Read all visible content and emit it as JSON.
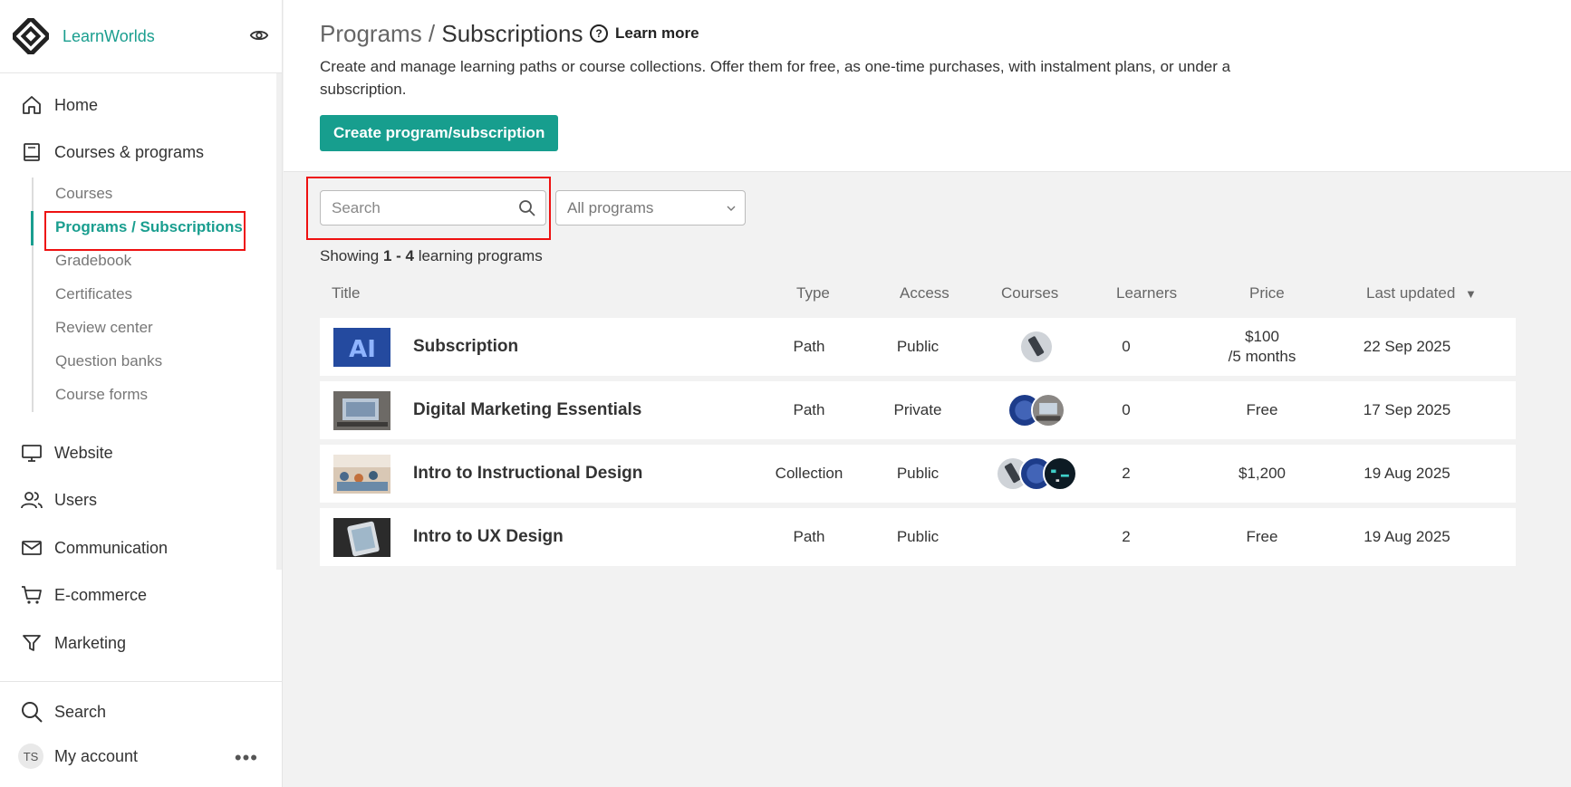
{
  "brand": {
    "name": "LearnWorlds"
  },
  "sidebar": {
    "items": [
      {
        "label": "Home",
        "icon": "home-icon"
      },
      {
        "label": "Courses & programs",
        "icon": "book-icon"
      },
      {
        "label": "Website",
        "icon": "monitor-icon"
      },
      {
        "label": "Users",
        "icon": "users-icon"
      },
      {
        "label": "Communication",
        "icon": "mail-icon"
      },
      {
        "label": "E-commerce",
        "icon": "cart-icon"
      },
      {
        "label": "Marketing",
        "icon": "funnel-icon"
      }
    ],
    "subitems": [
      {
        "label": "Courses"
      },
      {
        "label": "Programs / Subscriptions",
        "active": true
      },
      {
        "label": "Gradebook"
      },
      {
        "label": "Certificates"
      },
      {
        "label": "Review center"
      },
      {
        "label": "Question banks"
      },
      {
        "label": "Course forms"
      }
    ],
    "bottom": {
      "search_label": "Search",
      "account_label": "My account",
      "avatar_initials": "TS"
    }
  },
  "header": {
    "crumb": "Programs / ",
    "title": "Subscriptions",
    "learn_more": "Learn more",
    "description": "Create and manage learning paths or course collections. Offer them for free, as one-time purchases, with instalment plans, or under a subscription.",
    "create_button": "Create program/subscription"
  },
  "filters": {
    "search_placeholder": "Search",
    "program_filter": "All programs"
  },
  "showing": {
    "prefix": "Showing ",
    "range": "1 - 4",
    "suffix": " learning programs"
  },
  "table": {
    "columns": [
      "Title",
      "Type",
      "Access",
      "Courses",
      "Learners",
      "Price",
      "Last updated"
    ],
    "sort_indicator": "▼",
    "rows": [
      {
        "title": "Subscription",
        "type": "Path",
        "access": "Public",
        "learners": "0",
        "price": "$100\n/5 months",
        "updated": "22 Sep 2025"
      },
      {
        "title": "Digital Marketing Essentials",
        "type": "Path",
        "access": "Private",
        "learners": "0",
        "price": "Free",
        "updated": "17 Sep 2025"
      },
      {
        "title": "Intro to Instructional Design",
        "type": "Collection",
        "access": "Public",
        "learners": "2",
        "price": "$1,200",
        "updated": "19 Aug 2025"
      },
      {
        "title": "Intro to UX Design",
        "type": "Path",
        "access": "Public",
        "learners": "2",
        "price": "Free",
        "updated": "19 Aug 2025"
      }
    ]
  },
  "colors": {
    "accent": "#179e8e",
    "highlight": "#ee1111"
  }
}
